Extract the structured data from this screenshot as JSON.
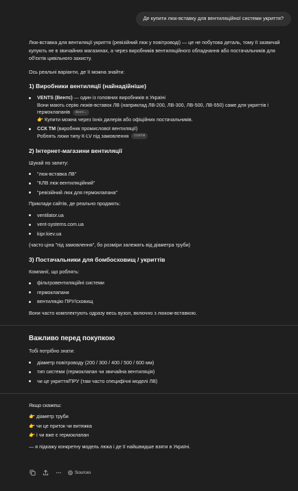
{
  "user_message": "Де купити люк-вставку для вентиляційної системи укриття?",
  "intro": "Люк-вставка для вентиляції укриття (ревізійний люк у повітроводі) — це не побутова деталь, тому її зазвичай купують не в звичайних магазинах, а через виробників вентиляційного обладнання або постачальників для об'єктів цивільного захисту.",
  "lead": "Ось реальні варіанти, де її можна знайти:",
  "s1": {
    "title": "1) Виробники вентиляції (найнадійніше)",
    "vents_name": "VENTS (Вентс)",
    "vents_text": " — один із головних виробників в Україні",
    "vents_desc": "Вони мають серію люків-вставок ЛВ (наприклад ЛВ-200, ЛВ-300, ЛВ-500, ЛВ-550) саме для укриттів і гермоклапанів",
    "vents_chip": "Вентс...",
    "vents_tip": "Купити можна через їхніх дилерів або офіційних постачальників.",
    "cck_name": "ССК ТМ",
    "cck_text": " (виробник промислової вентиляції)",
    "cck_desc": "Роблять люки типу К-LV під замовлення",
    "cck_chip": "ССКТМ"
  },
  "s2": {
    "title": "2) Інтернет-магазини вентиляції",
    "search_label": "Шукай по запиту:",
    "queries": [
      "\"люк-вставка ЛВ\"",
      "\"КЛВ люк вентиляційний\"",
      "\"ревізійний люк для гермоклапана\""
    ],
    "sites_label": "Приклади сайтів, де реально продають:",
    "sites": [
      "ventilator.ua",
      "vent-systems.com.ua",
      "kipr.kiev.ua"
    ],
    "note": "(часто ціна \"під замовлення\", бо розміри залежать від діаметра труби)"
  },
  "s3": {
    "title": "3) Постачальники для бомбосховищ / укриттів",
    "label": "Компанії, що роблять:",
    "items": [
      "фільтровентиляційні системи",
      "гермоклапани",
      "вентиляцію ПРУ/сховищ"
    ],
    "note": "Вони часто комплектують одразу весь вузол, включно з люком-вставкою."
  },
  "important": {
    "title": "Важливо перед покупкою",
    "label": "Тобі потрібно знати:",
    "items": [
      "діаметр повітроводу (200 / 300 / 400 / 500 / 600 мм)",
      "тип системи (гермоклапан чи звичайна вентиляція)",
      "чи це укриття/ПРУ (там часто специфічні моделі ЛВ)"
    ]
  },
  "outro": {
    "label": "Якщо скажеш:",
    "items": [
      "діаметр труби",
      "чи це приток чи витяжка",
      "і чи вже є гермоклапан"
    ],
    "closing": "— я підкажу конкретну модель люка і де її найшвидше взяти в Україні."
  },
  "actions": {
    "sources_label": "Sources"
  },
  "icons": {
    "copy": "copy-icon",
    "share": "share-icon",
    "more": "more-icon",
    "pointer": "pointing-hand-icon"
  }
}
